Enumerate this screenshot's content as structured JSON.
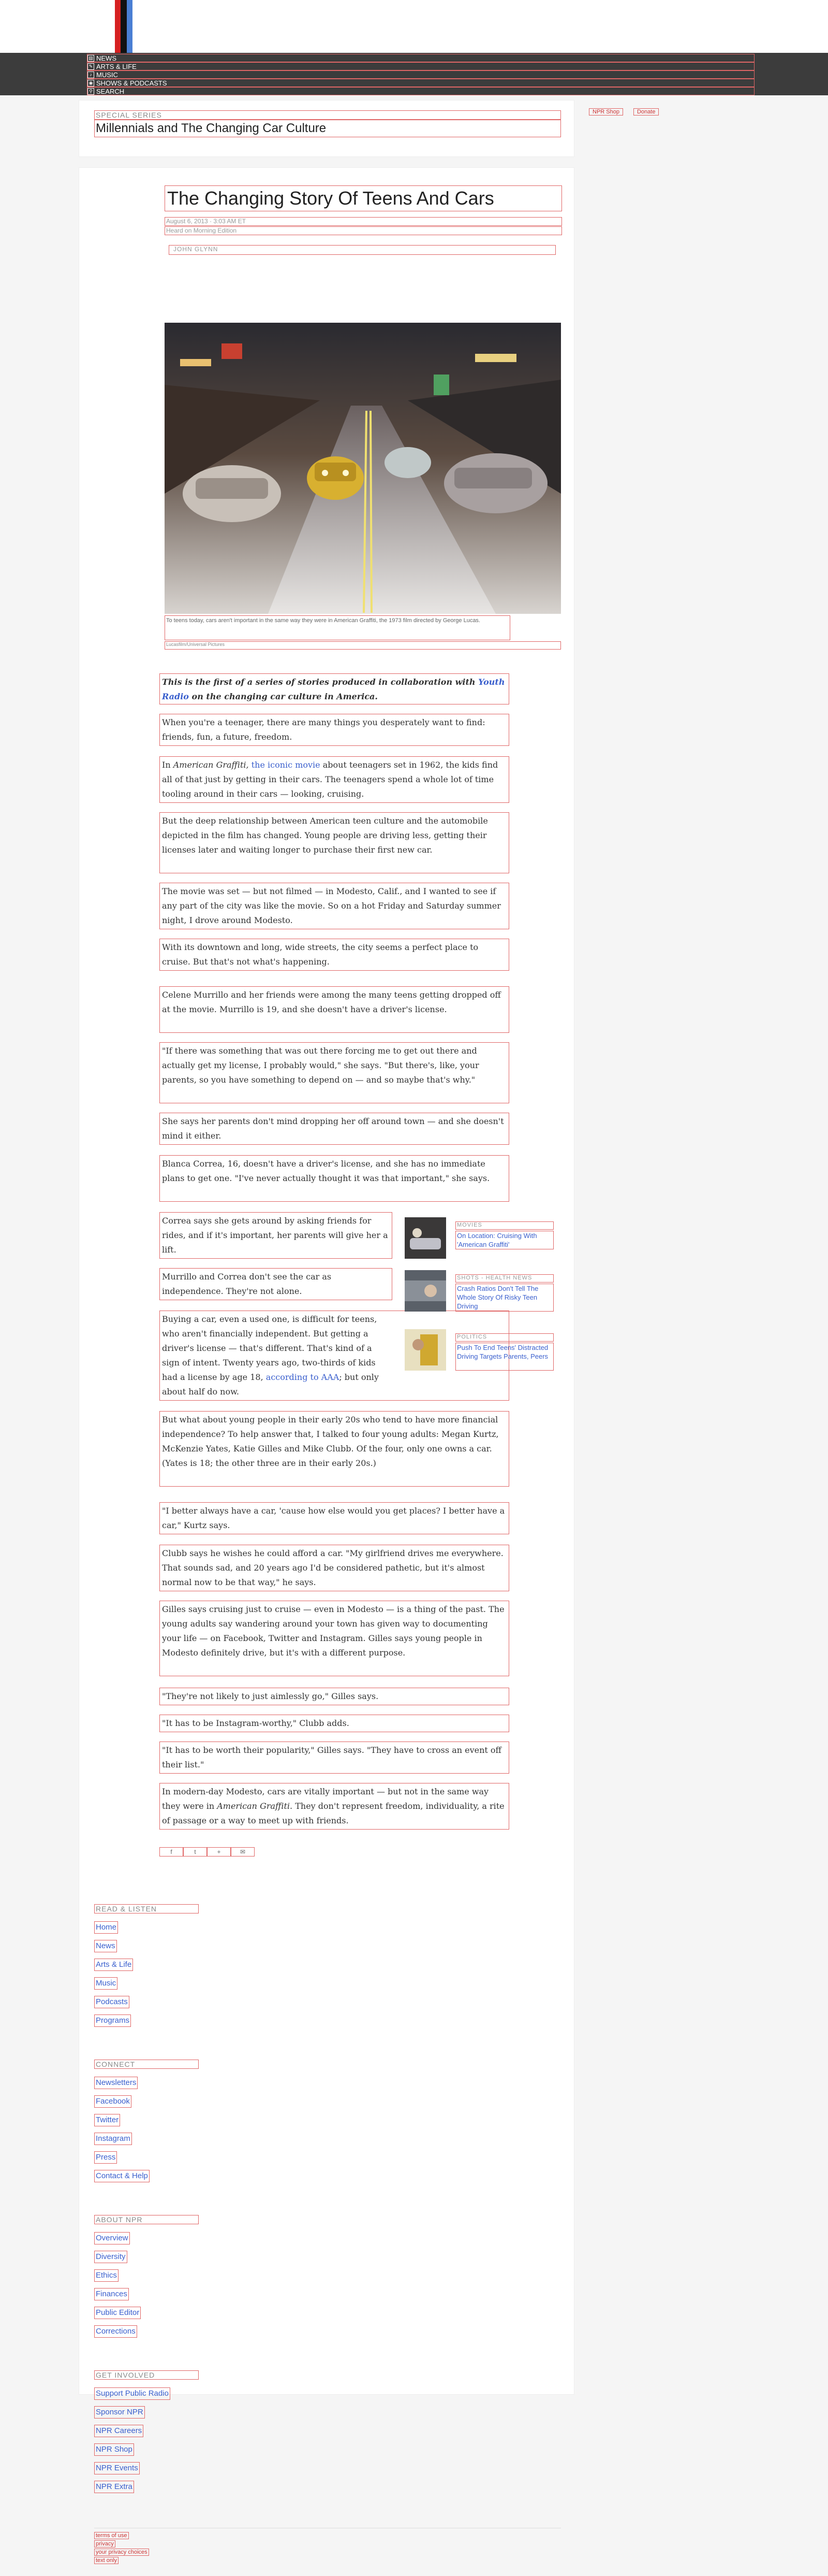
{
  "header": {
    "nav": [
      {
        "icon": "news-icon",
        "label": "NEWS"
      },
      {
        "icon": "arts-icon",
        "label": "ARTS & LIFE"
      },
      {
        "icon": "music-icon",
        "label": "MUSIC"
      },
      {
        "icon": "podcast-icon",
        "label": "SHOWS & PODCASTS"
      },
      {
        "icon": "search-icon",
        "label": "SEARCH"
      }
    ],
    "right_links": [
      "NPR Shop",
      "Donate"
    ]
  },
  "series": {
    "label": "SPECIAL SERIES",
    "title": "Millennials and The Changing Car Culture"
  },
  "article": {
    "title": "The Changing Story Of Teens And Cars",
    "date": "August 6, 2013 · 3:03 AM ET",
    "edition": "Heard on Morning Edition",
    "author": "JOHN GLYNN",
    "caption": "To teens today, cars aren't important in the same way they were in American Graffiti, the 1973 film directed by George Lucas.",
    "credit": "Lucasfilm/Universal Pictures",
    "intro_a": "This is the first of a series of stories produced in collaboration with",
    "intro_link": "Youth Radio",
    "intro_b": "on the changing car culture in America.",
    "p1": "When you're a teenager, there are many things you desperately want to find: friends, fun, a future, freedom.",
    "p2_a": "In",
    "p2_em": "American Graffiti,",
    "p2_link": "the iconic movie",
    "p2_b": "about teenagers set in 1962, the kids find all of that just by getting in their cars. The teenagers spend a whole lot of time tooling around in their cars — looking, cruising.",
    "p3": "But the deep relationship between American teen culture and the automobile depicted in the film has changed. Young people are driving less, getting their licenses later and waiting longer to purchase their first new car.",
    "p4": "The movie was set — but not filmed — in Modesto, Calif., and I wanted to see if any part of the city was like the movie. So on a hot Friday and Saturday summer night, I drove around Modesto.",
    "p5": "With its downtown and long, wide streets, the city seems a perfect place to cruise. But that's not what's happening.",
    "p6": "Celene Murrillo and her friends were among the many teens getting dropped off at the movie. Murrillo is 19, and she doesn't have a driver's license.",
    "p7": "\"If there was something that was out there forcing me to get out there and actually get my license, I probably would,\" she says. \"But there's, like, your parents, so you have something to depend on — and so maybe that's why.\"",
    "p8": "She says her parents don't mind dropping her off around town — and she doesn't mind it either.",
    "p9": "Blanca Correa, 16, doesn't have a driver's license, and she has no immediate plans to get one. \"I've never actually thought it was that important,\" she says.",
    "p10": "Correa says she gets around by asking friends for rides, and if it's important, her parents will give her a lift.",
    "p11": "Murrillo and Correa don't see the car as independence. They're not alone.",
    "p12_a": "Buying a car, even a used one, is difficult for teens, who aren't financially independent. But getting a driver's license — that's different. That's kind of a sign of intent. Twenty years ago, two-thirds of kids had a license by age 18,",
    "p12_link": "according to AAA",
    "p12_b": "; but only about half do now.",
    "p13": "But what about young people in their early 20s who tend to have more financial independence? To help answer that, I talked to four young adults: Megan Kurtz, McKenzie Yates, Katie Gilles and Mike Clubb. Of the four, only one owns a car. (Yates is 18; the other three are in their early 20s.)",
    "p14": "\"I better always have a car, 'cause how else would you get places? I better have a car,\" Kurtz says.",
    "p15": "Clubb says he wishes he could afford a car. \"My girlfriend drives me everywhere. That sounds sad, and 20 years ago I'd be considered pathetic, but it's almost normal now to be that way,\" he says.",
    "p16": "Gilles says cruising just to cruise — even in Modesto — is a thing of the past. The young adults say wandering around your town has given way to documenting your life — on Facebook, Twitter and Instagram. Gilles says young people in Modesto definitely drive, but it's with a different purpose.",
    "p17": "\"They're not likely to just aimlessly go,\" Gilles says.",
    "p18": "\"It has to be Instagram-worthy,\" Clubb adds.",
    "p19": "\"It has to be worth their popularity,\" Gilles says. \"They have to cross an event off their list.\"",
    "p20_a": "In modern-day Modesto, cars are vitally important — but not in the same way they were in",
    "p20_em": "American Graffiti.",
    "p20_b": "They don't represent freedom, individuality, a rite of passage or a way to meet up with friends."
  },
  "related": [
    {
      "kicker": "MOVIES",
      "title": "On Location: Cruising With 'American Graffiti'"
    },
    {
      "kicker": "SHOTS - HEALTH NEWS",
      "title": "Crash Ratios Don't Tell The Whole Story Of Risky Teen Driving"
    },
    {
      "kicker": "POLITICS",
      "title": "Push To End Teens' Distracted Driving Targets Parents, Peers"
    }
  ],
  "share": [
    "f",
    "t",
    "+",
    "✉"
  ],
  "footer": {
    "read": {
      "heading": "READ & LISTEN",
      "links": [
        "Home",
        "News",
        "Arts & Life",
        "Music",
        "Podcasts",
        "Programs"
      ]
    },
    "connect": {
      "heading": "CONNECT",
      "links": [
        "Newsletters",
        "Facebook",
        "Twitter",
        "Instagram",
        "Press",
        "Contact & Help"
      ]
    },
    "about": {
      "heading": "ABOUT NPR",
      "links": [
        "Overview",
        "Diversity",
        "Ethics",
        "Finances",
        "Public Editor",
        "Corrections"
      ]
    },
    "involved": {
      "heading": "GET INVOLVED",
      "links": [
        "Support Public Radio",
        "Sponsor NPR",
        "NPR Careers",
        "NPR Shop",
        "NPR Events",
        "NPR Extra"
      ]
    },
    "legal": [
      "terms of use",
      "privacy",
      "your privacy choices",
      "text only"
    ]
  },
  "colors": {
    "nav_bg": "#3c3c3c",
    "link": "#3a5fcd",
    "logo_red": "#d62021",
    "logo_black": "#111111",
    "logo_blue": "#4a7fd4"
  }
}
